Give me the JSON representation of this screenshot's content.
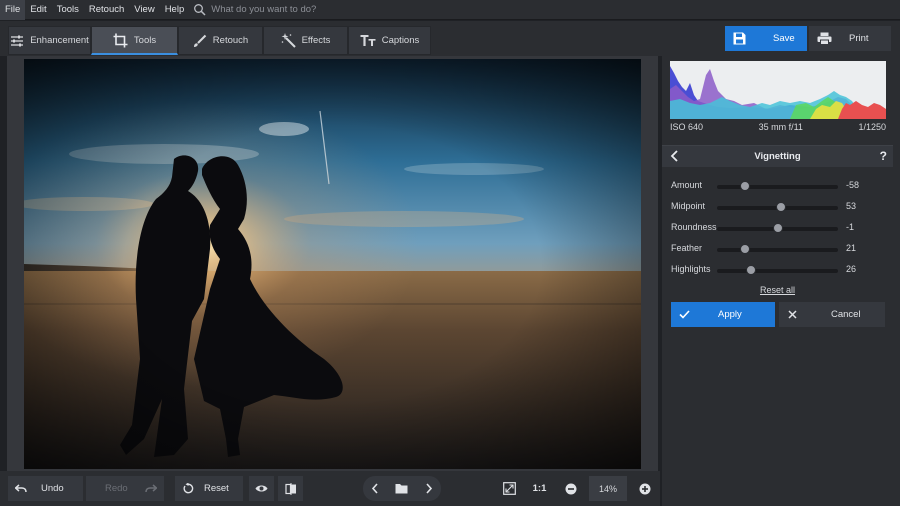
{
  "menu": [
    "File",
    "Edit",
    "Tools",
    "Retouch",
    "View",
    "Help"
  ],
  "search": {
    "placeholder": "What do you want to do?"
  },
  "tabs": [
    {
      "label": "Enhancement",
      "icon": "sliders-icon"
    },
    {
      "label": "Tools",
      "icon": "crop-icon",
      "active": true
    },
    {
      "label": "Retouch",
      "icon": "brush-icon"
    },
    {
      "label": "Effects",
      "icon": "magic-wand-icon"
    },
    {
      "label": "Captions",
      "icon": "text-icon"
    }
  ],
  "actions": {
    "save": "Save",
    "print": "Print"
  },
  "exif": {
    "iso": "ISO 640",
    "lens": "35 mm f/11",
    "shutter": "1/1250"
  },
  "panel": {
    "title": "Vignetting",
    "help": "?",
    "sliders": [
      {
        "label": "Amount",
        "value": "-58",
        "fraction": 0.23
      },
      {
        "label": "Midpoint",
        "value": "53",
        "fraction": 0.53
      },
      {
        "label": "Roundness",
        "value": "-1",
        "fraction": 0.5
      },
      {
        "label": "Feather",
        "value": "21",
        "fraction": 0.23
      },
      {
        "label": "Highlights",
        "value": "26",
        "fraction": 0.28
      }
    ],
    "reset_all": "Reset all",
    "apply": "Apply",
    "cancel": "Cancel"
  },
  "bottom": {
    "undo": "Undo",
    "redo": "Redo",
    "reset": "Reset",
    "ratio": "1:1",
    "zoom": "14%"
  },
  "colors": {
    "accent": "#1e78d7",
    "panel": "#2b2d31",
    "canvas": "#35373c"
  }
}
